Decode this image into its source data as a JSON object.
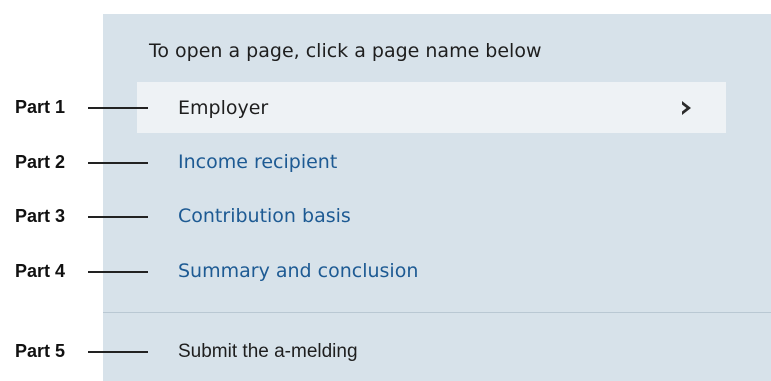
{
  "instruction": "To open a page, click a page name below",
  "pages": [
    {
      "label": "Employer",
      "active": true
    },
    {
      "label": "Income recipient"
    },
    {
      "label": "Contribution basis"
    },
    {
      "label": "Summary and conclusion"
    }
  ],
  "submit_label": "Submit the a-melding",
  "parts": [
    "Part 1",
    "Part 2",
    "Part 3",
    "Part 4",
    "Part 5"
  ],
  "colors": {
    "panel_background": "#d7e2ea",
    "active_row_background": "#eef2f5",
    "link": "#1d5a93",
    "text": "#1e1e1e"
  },
  "icons": {
    "active_row_arrow": "chevron-right-icon"
  }
}
